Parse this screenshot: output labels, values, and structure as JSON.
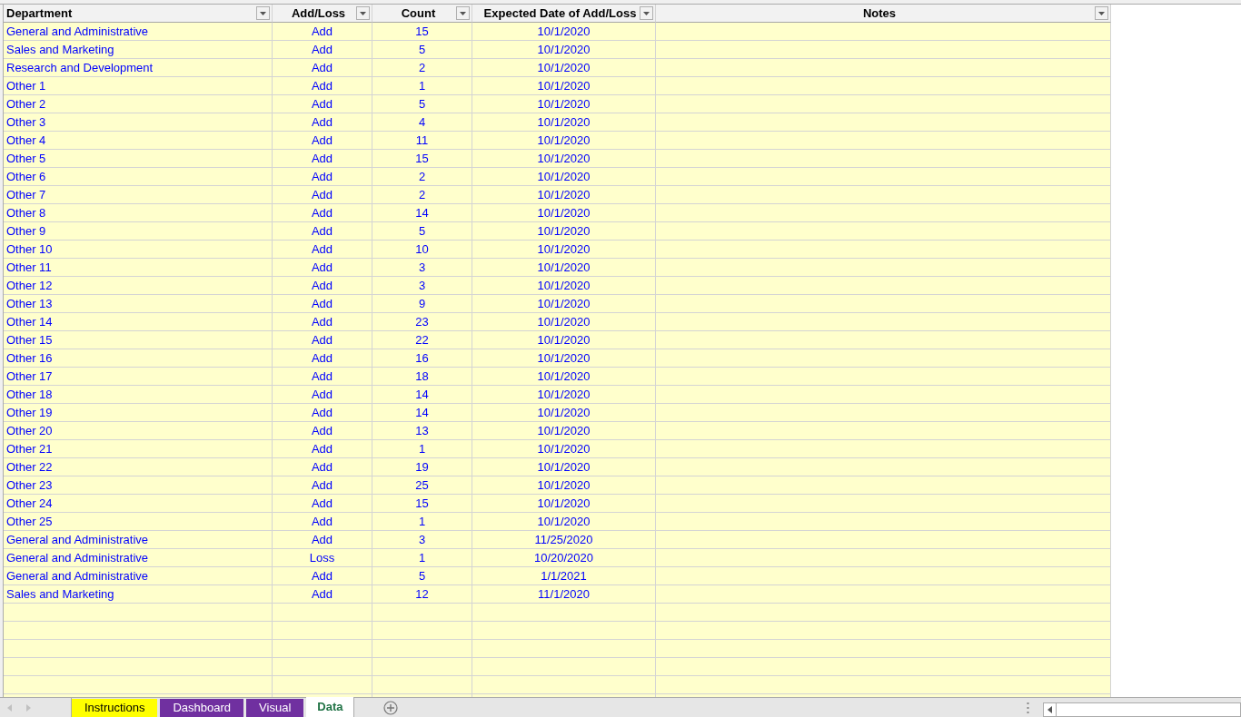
{
  "table": {
    "columns": [
      {
        "label": "Department"
      },
      {
        "label": "Add/Loss"
      },
      {
        "label": "Count"
      },
      {
        "label": "Expected Date of Add/Loss"
      },
      {
        "label": "Notes"
      }
    ],
    "rows": [
      [
        "General and Administrative",
        "Add",
        "15",
        "10/1/2020"
      ],
      [
        "Sales and Marketing",
        "Add",
        "5",
        "10/1/2020"
      ],
      [
        "Research and Development",
        "Add",
        "2",
        "10/1/2020"
      ],
      [
        "Other 1",
        "Add",
        "1",
        "10/1/2020"
      ],
      [
        "Other 2",
        "Add",
        "5",
        "10/1/2020"
      ],
      [
        "Other 3",
        "Add",
        "4",
        "10/1/2020"
      ],
      [
        "Other 4",
        "Add",
        "11",
        "10/1/2020"
      ],
      [
        "Other 5",
        "Add",
        "15",
        "10/1/2020"
      ],
      [
        "Other 6",
        "Add",
        "2",
        "10/1/2020"
      ],
      [
        "Other 7",
        "Add",
        "2",
        "10/1/2020"
      ],
      [
        "Other 8",
        "Add",
        "14",
        "10/1/2020"
      ],
      [
        "Other 9",
        "Add",
        "5",
        "10/1/2020"
      ],
      [
        "Other 10",
        "Add",
        "10",
        "10/1/2020"
      ],
      [
        "Other 11",
        "Add",
        "3",
        "10/1/2020"
      ],
      [
        "Other 12",
        "Add",
        "3",
        "10/1/2020"
      ],
      [
        "Other 13",
        "Add",
        "9",
        "10/1/2020"
      ],
      [
        "Other 14",
        "Add",
        "23",
        "10/1/2020"
      ],
      [
        "Other 15",
        "Add",
        "22",
        "10/1/2020"
      ],
      [
        "Other 16",
        "Add",
        "16",
        "10/1/2020"
      ],
      [
        "Other 17",
        "Add",
        "18",
        "10/1/2020"
      ],
      [
        "Other 18",
        "Add",
        "14",
        "10/1/2020"
      ],
      [
        "Other 19",
        "Add",
        "14",
        "10/1/2020"
      ],
      [
        "Other 20",
        "Add",
        "13",
        "10/1/2020"
      ],
      [
        "Other 21",
        "Add",
        "1",
        "10/1/2020"
      ],
      [
        "Other 22",
        "Add",
        "19",
        "10/1/2020"
      ],
      [
        "Other 23",
        "Add",
        "25",
        "10/1/2020"
      ],
      [
        "Other 24",
        "Add",
        "15",
        "10/1/2020"
      ],
      [
        "Other 25",
        "Add",
        "1",
        "10/1/2020"
      ],
      [
        "General and Administrative",
        "Add",
        "3",
        "11/25/2020"
      ],
      [
        "General and Administrative",
        "Loss",
        "1",
        "10/20/2020"
      ],
      [
        "General and Administrative",
        "Add",
        "5",
        "1/1/2021"
      ],
      [
        "Sales and Marketing",
        "Add",
        "12",
        "11/1/2020"
      ]
    ]
  },
  "sheet_tabs": [
    {
      "label": "Instructions",
      "color": "#ffff00",
      "selected": false
    },
    {
      "label": "Dashboard",
      "color": "#7030a0",
      "selected": false
    },
    {
      "label": "Visual",
      "color": "#7030a0",
      "selected": false
    },
    {
      "label": "Data",
      "color": "#ffffff",
      "selected": true
    }
  ]
}
